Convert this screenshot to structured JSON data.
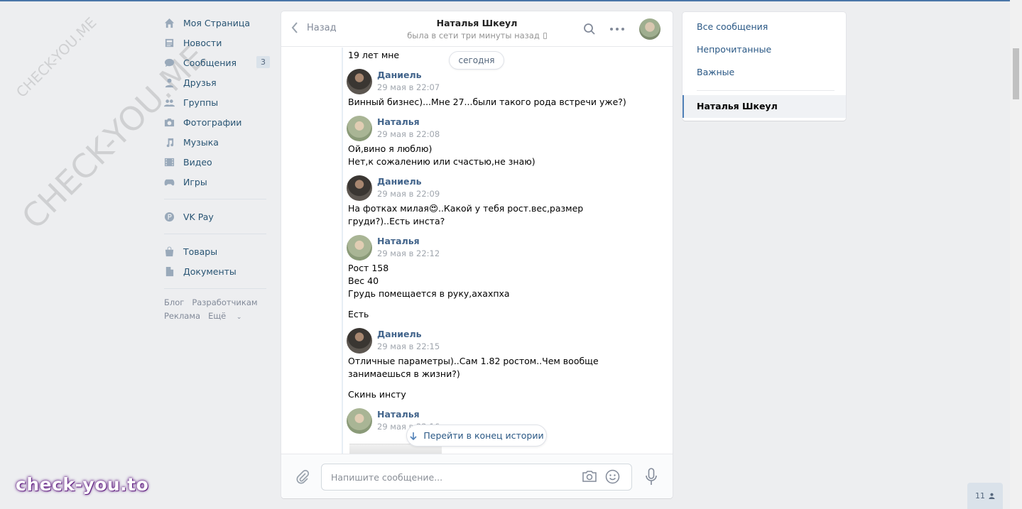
{
  "nav": {
    "items": [
      {
        "label": "Моя Страница",
        "icon": "home-icon"
      },
      {
        "label": "Новости",
        "icon": "news-icon"
      },
      {
        "label": "Сообщения",
        "icon": "messages-icon",
        "badge": "3"
      },
      {
        "label": "Друзья",
        "icon": "friends-icon"
      },
      {
        "label": "Группы",
        "icon": "groups-icon"
      },
      {
        "label": "Фотографии",
        "icon": "photos-icon"
      },
      {
        "label": "Музыка",
        "icon": "music-icon"
      },
      {
        "label": "Видео",
        "icon": "video-icon"
      },
      {
        "label": "Игры",
        "icon": "games-icon"
      }
    ],
    "pay": {
      "label": "VK Pay",
      "icon": "vkpay-icon"
    },
    "extra": [
      {
        "label": "Товары",
        "icon": "market-icon"
      },
      {
        "label": "Документы",
        "icon": "documents-icon"
      }
    ],
    "footer": {
      "blog": "Блог",
      "dev": "Разработчикам",
      "ads": "Реклама",
      "more": "Ещё"
    }
  },
  "watermark": {
    "big": "CHECK-YOU.ME",
    "small": "CHECK-YOU.ME",
    "brand": "check-you.to"
  },
  "chat": {
    "back": "Назад",
    "peer_name": "Наталья Шкеул",
    "peer_status": "была в сети три минуты назад",
    "today": "сегодня",
    "first_line": "19 лет мне",
    "messages": [
      {
        "author": "Даниель",
        "date": "29 мая в 22:07",
        "kind": "d",
        "lines": [
          "Винный бизнес)...Мне 27...были такого рода встречи уже?)"
        ]
      },
      {
        "author": "Наталья",
        "date": "29 мая в 22:08",
        "kind": "n",
        "lines": [
          "Ой,вино я люблю)",
          "Нет,к сожалению или счастью,не знаю)"
        ]
      },
      {
        "author": "Даниель",
        "date": "29 мая в 22:09",
        "kind": "d",
        "lines": [
          "На фотках милая😍..Какой у тебя рост.вес,размер",
          "груди?)..Есть инста?"
        ]
      },
      {
        "author": "Наталья",
        "date": "29 мая в 22:12",
        "kind": "n",
        "lines": [
          "Рост 158",
          "Вес 40",
          "Грудь помещается в руку,ахахпха"
        ],
        "extra": "Есть"
      },
      {
        "author": "Даниель",
        "date": "29 мая в 22:15",
        "kind": "d",
        "lines": [
          "Отличные параметры)..Сам 1.82 ростом..Чем вообще",
          "занимаешься в жизни?)"
        ],
        "extra": "Скинь инсту"
      },
      {
        "author": "Наталья",
        "date": "29 мая в 22:16",
        "kind": "n",
        "lines": []
      }
    ],
    "jump": "Перейти в конец истории",
    "composer_placeholder": "Напишите сообщение..."
  },
  "right": {
    "all": "Все сообщения",
    "unread": "Непрочитанные",
    "important": "Важные",
    "active": "Наталья Шкеул"
  },
  "counter": "11"
}
